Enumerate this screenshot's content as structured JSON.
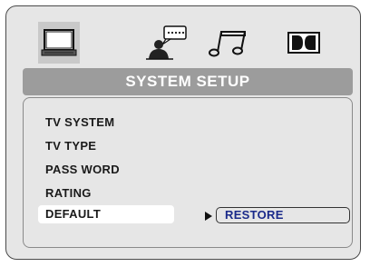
{
  "header": {
    "icons": [
      {
        "name": "tv-icon",
        "active": true
      },
      {
        "name": "speech-person-icon",
        "active": false
      },
      {
        "name": "music-note-icon",
        "active": false
      },
      {
        "name": "dolby-icon",
        "active": false
      }
    ]
  },
  "title": "SYSTEM SETUP",
  "menu": {
    "items": [
      {
        "label": "TV SYSTEM",
        "selected": false
      },
      {
        "label": "TV TYPE",
        "selected": false
      },
      {
        "label": "PASS WORD",
        "selected": false
      },
      {
        "label": "RATING",
        "selected": false
      },
      {
        "label": "DEFAULT",
        "selected": true
      }
    ]
  },
  "submenu": {
    "option": "RESTORE"
  },
  "colors": {
    "panel_bg": "#e6e6e6",
    "title_bar": "#9c9c9c",
    "selected_bg": "#ffffff",
    "option_text": "#1a2a8a"
  }
}
